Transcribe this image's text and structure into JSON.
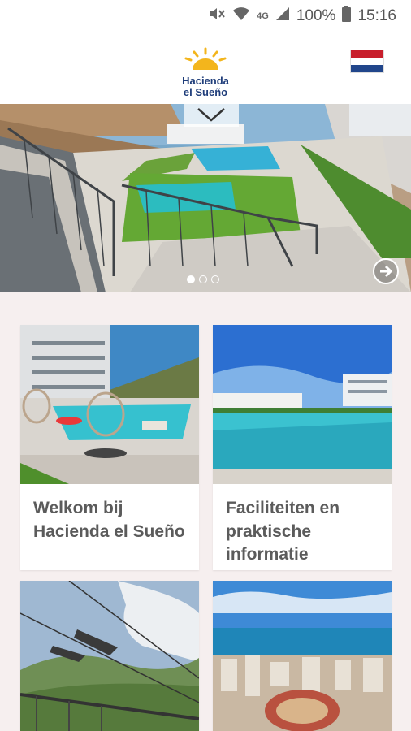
{
  "status_bar": {
    "signal_label": "4G",
    "battery": "100%",
    "time": "15:16"
  },
  "header": {
    "logo_line1": "Hacienda",
    "logo_line2": "el Sueño"
  },
  "hero": {
    "slides_total": 3,
    "active_slide": 1
  },
  "cards": [
    {
      "title": "Welkom bij Hacienda el Sueño"
    },
    {
      "title": "Faciliteiten en praktische informatie"
    },
    {
      "title": ""
    },
    {
      "title": ""
    }
  ],
  "colors": {
    "brand_navy": "#1f3d7a",
    "sun_yellow": "#f3b51c",
    "background": "#f6efef"
  }
}
